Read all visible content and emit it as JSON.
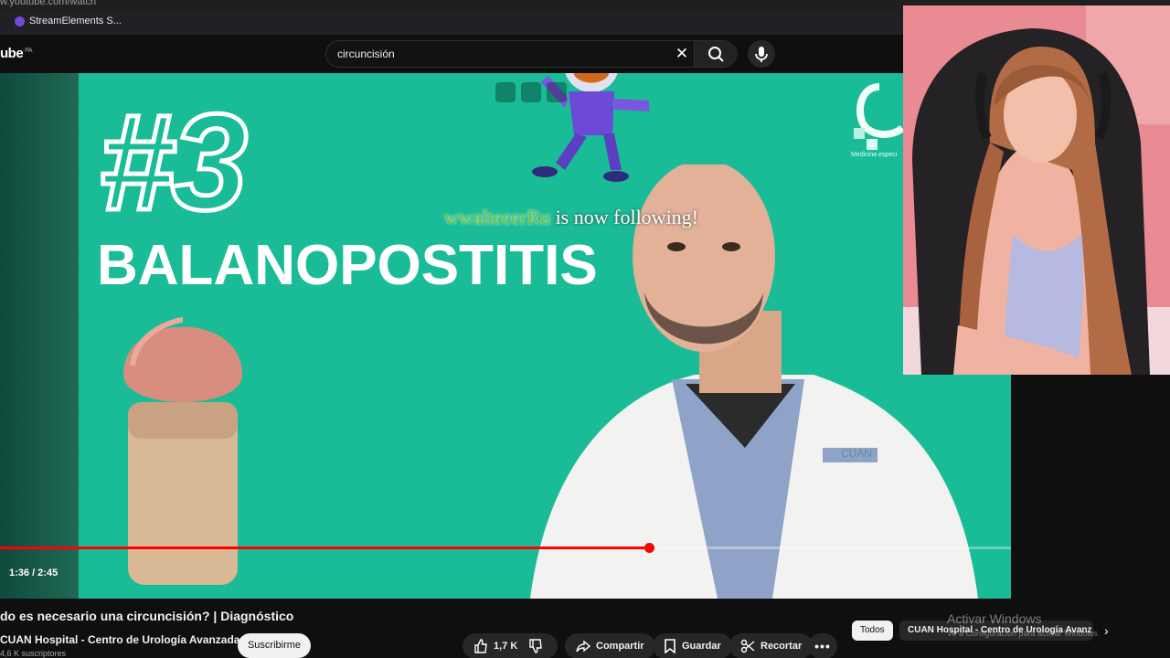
{
  "browser": {
    "url": "w.youtube.com/watch",
    "bookmark_label": "StreamElements S..."
  },
  "header": {
    "logo_text": "ube",
    "logo_region": "PA",
    "search_value": "circuncisión"
  },
  "video": {
    "overlay_number": "#3",
    "overlay_title": "BALANOPOSTITIS",
    "follow_name": "wwalteeerRu",
    "follow_text": " is now following!",
    "clinic_tagline": "Medicina especi",
    "coat_logo": "CUAN",
    "time_display": "1:36 / 2:45",
    "progress_fraction": 0.5545
  },
  "below": {
    "title": "do es necesario una circuncisión? | Diagnóstico",
    "channel_name": "CUAN Hospital - Centro de Urología Avanzada",
    "subscriber_count": "4,6 K suscriptores",
    "subscribe_label": "Suscribirme",
    "like_count": "1,7 K",
    "share_label": "Compartir",
    "save_label": "Guardar",
    "clip_label": "Recortar",
    "chip_all": "Todos",
    "chip_channel": "CUAN Hospital - Centro de Urología Avanz",
    "watermark_title": "Activar Windows",
    "watermark_sub": "Ve a Configuración para activar Windows."
  },
  "colors": {
    "accent": "#ff0000",
    "video_bg": "#19bc96"
  }
}
